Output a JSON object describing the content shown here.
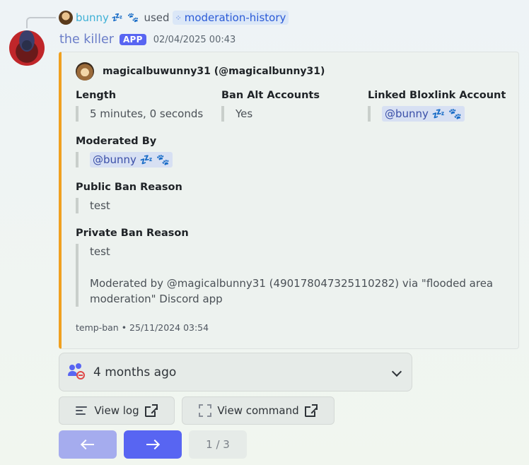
{
  "reply": {
    "username": "bunny",
    "deco": "💤 🐾",
    "used": "used",
    "command": "moderation-history"
  },
  "message": {
    "author": "the killer",
    "tag": "APP",
    "timestamp": "02/04/2025 00:43"
  },
  "embed": {
    "author": "magicalbuwunny31 (@magicalbunny31)",
    "accent_color": "#f0a020",
    "fields": {
      "length": {
        "name": "Length",
        "value": "5 minutes, 0 seconds"
      },
      "ban_alt": {
        "name": "Ban Alt Accounts",
        "value": "Yes"
      },
      "linked": {
        "name": "Linked Bloxlink Account",
        "value": "@bunny 💤 🐾"
      },
      "moderated_by": {
        "name": "Moderated By",
        "value": "@bunny 💤 🐾"
      },
      "public_reason": {
        "name": "Public Ban Reason",
        "value": "test"
      },
      "private_reason": {
        "name": "Private Ban Reason",
        "value_line1": "test",
        "value_line2": "Moderated by @magicalbunny31 (490178047325110282) via \"flooded area",
        "value_line3": "moderation\" Discord app"
      }
    },
    "footer": "temp-ban • 25/11/2024 03:54"
  },
  "select": {
    "selected": "4 months ago"
  },
  "buttons": {
    "view_log": "View log",
    "view_command": "View command"
  },
  "pagination": {
    "page": "1 / 3"
  },
  "colors": {
    "brand": "#5865f2",
    "link": "#3eb0d6"
  }
}
